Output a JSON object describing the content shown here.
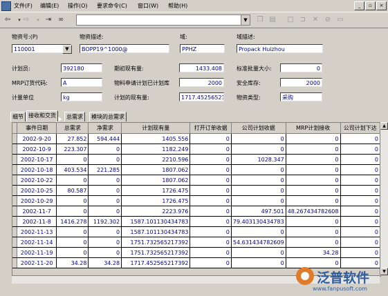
{
  "menu": {
    "items": [
      "文件(F)",
      "编辑(E)",
      "操作(O)",
      "要求命令(C)",
      "窗口(W)",
      "帮助(H)"
    ]
  },
  "window_controls": [
    "_",
    "▫",
    "×"
  ],
  "toolbar": {
    "icons": [
      "back-arrow",
      "forward-arrow",
      "insert-row",
      "binoculars"
    ],
    "combo_value": ""
  },
  "form": {
    "material_no": {
      "label": "物资号:(P)",
      "value": "110001"
    },
    "material_desc": {
      "label": "物资描述:",
      "value": "BOPP19^1000@"
    },
    "domain": {
      "label": "域:",
      "value": "PPHZ"
    },
    "domain_desc": {
      "label": "域描述:",
      "value": "Propack Huizhou"
    },
    "planner": {
      "label": "计划员:",
      "value": "392180"
    },
    "opening_stock": {
      "label": "期初现有量:",
      "value": "1433.408"
    },
    "std_batch": {
      "label": "标准批量大小:",
      "value": "0"
    },
    "mrp_order_code": {
      "label": "MRP订货代码:",
      "value": "A"
    },
    "req_plan_order": {
      "label": "物料申请计划已计划库",
      "value": "2000"
    },
    "safety_stock": {
      "label": "安全库存:",
      "value": "2000"
    },
    "unit": {
      "label": "计量单位",
      "value": "kg"
    },
    "planned_onhand": {
      "label": "计划的现有量:",
      "value": "1717.45256521"
    },
    "material_type": {
      "label": "物资类型:",
      "value": "采购"
    }
  },
  "tabs": [
    "细节",
    "接收和交货",
    "总需求",
    "模块的总需求"
  ],
  "table": {
    "columns": [
      "事件日期",
      "总需求",
      "净需求",
      "计划现有量",
      "打开订单收据",
      "公司计划收据",
      "MRP计划接收",
      "公司计划下达"
    ],
    "rows": [
      [
        "2002-9-20",
        "27.852",
        "594.444",
        "1405.556",
        "0",
        "0",
        "0",
        "0"
      ],
      [
        "2002-10-9",
        "223.307",
        "0",
        "1182.249",
        "0",
        "0",
        "0",
        "0"
      ],
      [
        "2002-10-17",
        "0",
        "0",
        "2210.596",
        "0",
        "1028.347",
        "0",
        "0"
      ],
      [
        "2002-10-18",
        "403.534",
        "221.285",
        "1807.062",
        "0",
        "0",
        "0",
        "0"
      ],
      [
        "2002-10-22",
        "0",
        "0",
        "1807.062",
        "0",
        "0",
        "0",
        "0"
      ],
      [
        "2002-10-25",
        "80.587",
        "0",
        "1726.475",
        "0",
        "0",
        "0",
        "0"
      ],
      [
        "2002-10-29",
        "0",
        "0",
        "1726.475",
        "0",
        "0",
        "0",
        "0"
      ],
      [
        "2002-11-7",
        "0",
        "0",
        "2223.976",
        "0",
        "497.501",
        "48.267434782608",
        "0"
      ],
      [
        "2002-11-8",
        "1416.278",
        "1192.302",
        "1587.101130434783",
        "0",
        "79.403130434783",
        "0",
        "0"
      ],
      [
        "2002-11-13",
        "0",
        "0",
        "1587.101130434783",
        "0",
        "0",
        "0",
        "0"
      ],
      [
        "2002-11-14",
        "0",
        "0",
        "1751.732565217392",
        "0",
        "54.631434782609",
        "0",
        "0"
      ],
      [
        "2002-11-19",
        "0",
        "0",
        "1751.732565217392",
        "0",
        "0",
        "34.28",
        "0"
      ],
      [
        "2002-11-20",
        "34.28",
        "34.28",
        "1717.452565217392",
        "0",
        "0",
        "0",
        "0"
      ]
    ]
  },
  "watermark": {
    "brand": "泛普软件",
    "url": "www.fanpusoft.com",
    "color": "#2f5d9e",
    "accent": "#e07b2a"
  }
}
